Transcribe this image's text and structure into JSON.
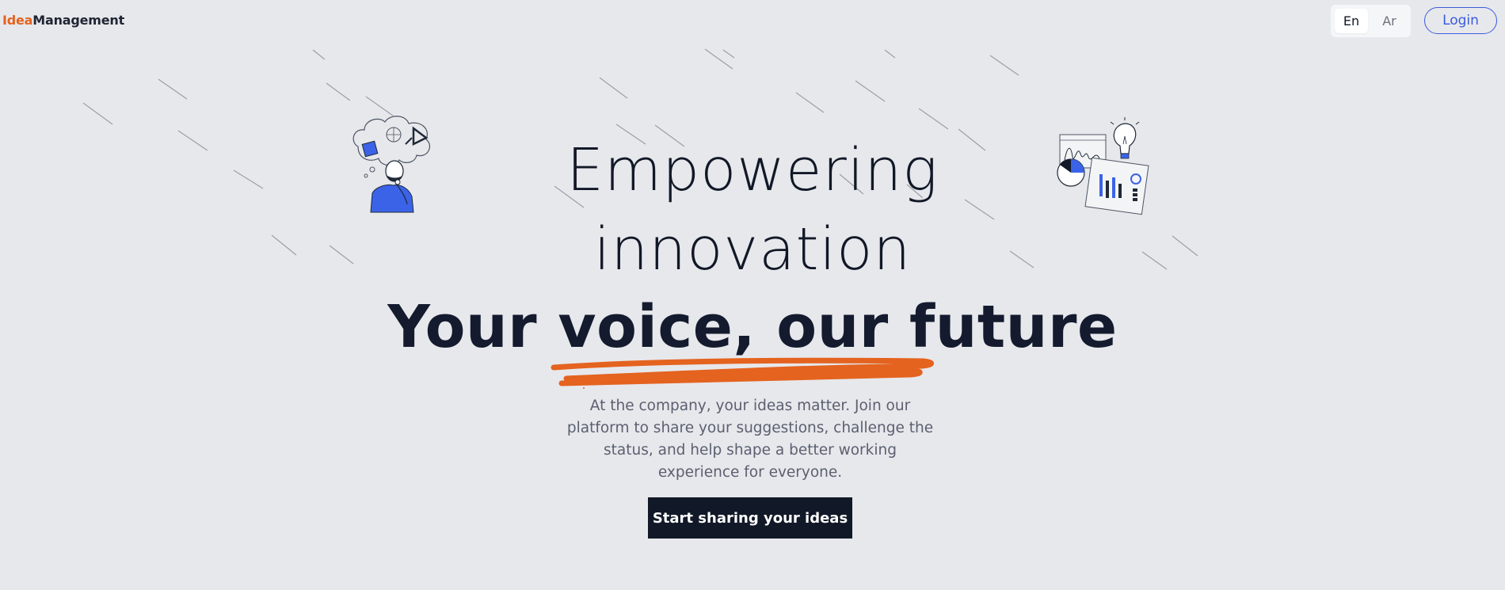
{
  "header": {
    "logo_part1": "Idea",
    "logo_part2": "Management",
    "lang_en": "En",
    "lang_ar": "Ar",
    "active_lang": "En",
    "login_label": "Login"
  },
  "hero": {
    "line1": "Empowering",
    "line2": "innovation",
    "line3": "Your voice, our future",
    "description": "At the company, your ideas matter. Join our platform to share your suggestions, challenge the status, and help shape a better working experience for everyone.",
    "cta_label": "Start sharing your ideas"
  },
  "colors": {
    "accent_orange": "#e4631f",
    "accent_blue": "#3b5bdb",
    "dark": "#111827",
    "background": "#e7e8ec"
  },
  "icons": [
    "thinking-person-illustration",
    "analytics-lightbulb-illustration"
  ]
}
